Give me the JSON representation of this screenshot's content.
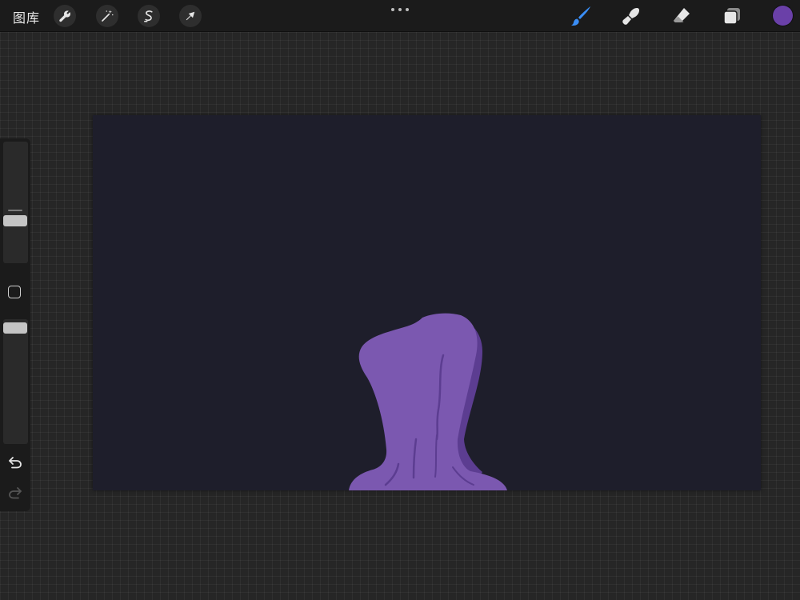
{
  "toolbar": {
    "gallery_label": "图库",
    "left_tools": [
      {
        "icon": "wrench-icon"
      },
      {
        "icon": "magic-wand-icon"
      },
      {
        "icon": "selection-s-icon"
      },
      {
        "icon": "transform-arrow-icon"
      }
    ],
    "right_tools": [
      {
        "icon": "brush-icon",
        "active": true
      },
      {
        "icon": "smudge-icon"
      },
      {
        "icon": "eraser-icon"
      },
      {
        "icon": "layers-icon"
      }
    ],
    "current_color": "#6a40a8",
    "active_tool_color": "#3a8ef6"
  },
  "sidebar": {
    "brush_size_level": 0.33,
    "opacity_level": 0.97,
    "undo_icon": "undo-icon",
    "redo_icon": "redo-icon"
  },
  "canvas": {
    "background": "#1e1e2b",
    "figure_fill": "#7b58b0",
    "figure_shadow": "#5c3d91"
  }
}
